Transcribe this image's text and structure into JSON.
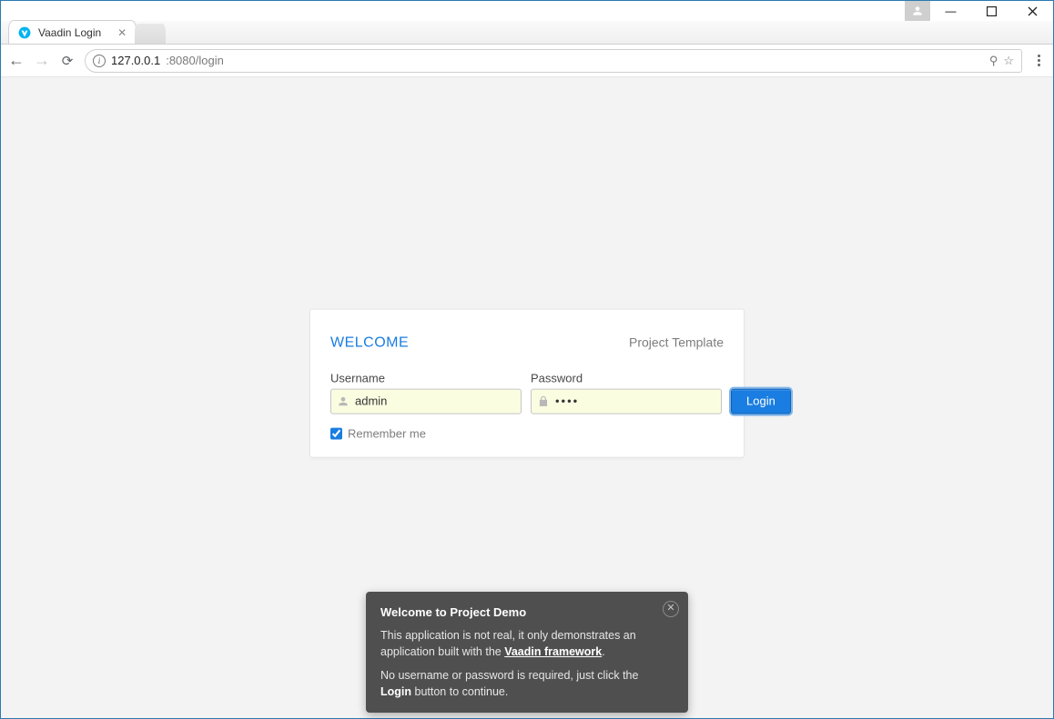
{
  "window": {
    "tab_title": "Vaadin Login",
    "url_host": "127.0.0.1",
    "url_path": ":8080/login"
  },
  "login": {
    "welcome": "WELCOME",
    "project_name": "Project Template",
    "username_label": "Username",
    "username_value": "admin",
    "password_label": "Password",
    "password_value": "••••",
    "login_button": "Login",
    "remember_label": "Remember me",
    "remember_checked": true
  },
  "toast": {
    "title": "Welcome to Project Demo",
    "line1a": "This application is not real, it only demonstrates an application built with the ",
    "line1_link": "Vaadin framework",
    "line1b": ".",
    "line2a": "No username or password is required, just click the ",
    "line2_bold": "Login",
    "line2b": " button to continue."
  }
}
